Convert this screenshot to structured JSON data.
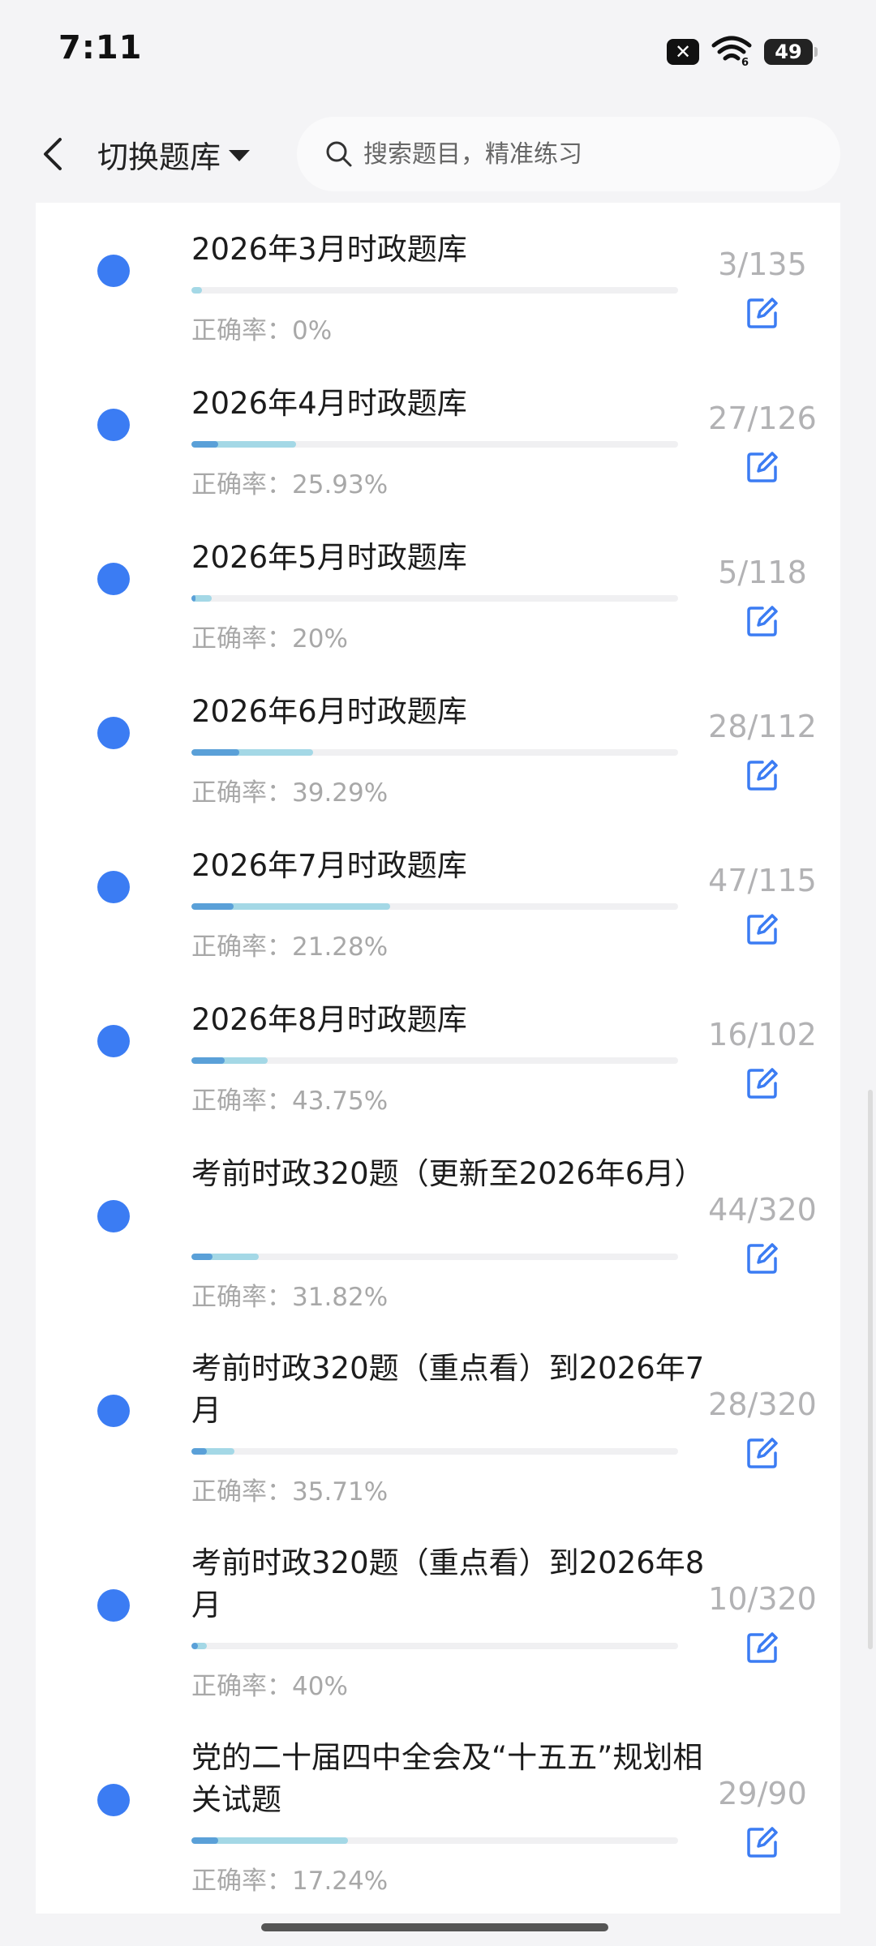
{
  "status_bar": {
    "time": "7:11",
    "battery_level": "49",
    "icons": [
      "close-badge-icon",
      "wifi-6-icon",
      "battery-icon"
    ]
  },
  "nav": {
    "back_icon": "chevron-left-icon",
    "switch_label": "切换题库",
    "switch_icon": "caret-down-icon",
    "search_placeholder": "搜索题目，精准练习"
  },
  "accuracy_prefix": "正确率：",
  "colors": {
    "dot": "#3b7cf3",
    "progress_done": "#a4d8e6",
    "progress_correct": "#5aa0d8",
    "edit_icon": "#3b7cf3"
  },
  "items": [
    {
      "title": "2026年3月时政题库",
      "done": 3,
      "total": 135,
      "accuracy_value": 0,
      "accuracy": "0%",
      "count": "3/135"
    },
    {
      "title": "2026年4月时政题库",
      "done": 27,
      "total": 126,
      "accuracy_value": 25.93,
      "accuracy": "25.93%",
      "count": "27/126"
    },
    {
      "title": "2026年5月时政题库",
      "done": 5,
      "total": 118,
      "accuracy_value": 20,
      "accuracy": "20%",
      "count": "5/118"
    },
    {
      "title": "2026年6月时政题库",
      "done": 28,
      "total": 112,
      "accuracy_value": 39.29,
      "accuracy": "39.29%",
      "count": "28/112"
    },
    {
      "title": "2026年7月时政题库",
      "done": 47,
      "total": 115,
      "accuracy_value": 21.28,
      "accuracy": "21.28%",
      "count": "47/115"
    },
    {
      "title": "2026年8月时政题库",
      "done": 16,
      "total": 102,
      "accuracy_value": 43.75,
      "accuracy": "43.75%",
      "count": "16/102"
    },
    {
      "title": "考前时政320题（更新至2026年6月）",
      "done": 44,
      "total": 320,
      "accuracy_value": 31.82,
      "accuracy": "31.82%",
      "count": "44/320"
    },
    {
      "title": "考前时政320题（重点看）到2026年7月",
      "done": 28,
      "total": 320,
      "accuracy_value": 35.71,
      "accuracy": "35.71%",
      "count": "28/320"
    },
    {
      "title": "考前时政320题（重点看）到2026年8月",
      "done": 10,
      "total": 320,
      "accuracy_value": 40,
      "accuracy": "40%",
      "count": "10/320"
    },
    {
      "title": "党的二十届四中全会及“十五五”规划相关试题",
      "done": 29,
      "total": 90,
      "accuracy_value": 17.24,
      "accuracy": "17.24%",
      "count": "29/90"
    }
  ],
  "item_icons": {
    "bullet": "blue-dot-icon",
    "edit": "edit-note-icon"
  }
}
